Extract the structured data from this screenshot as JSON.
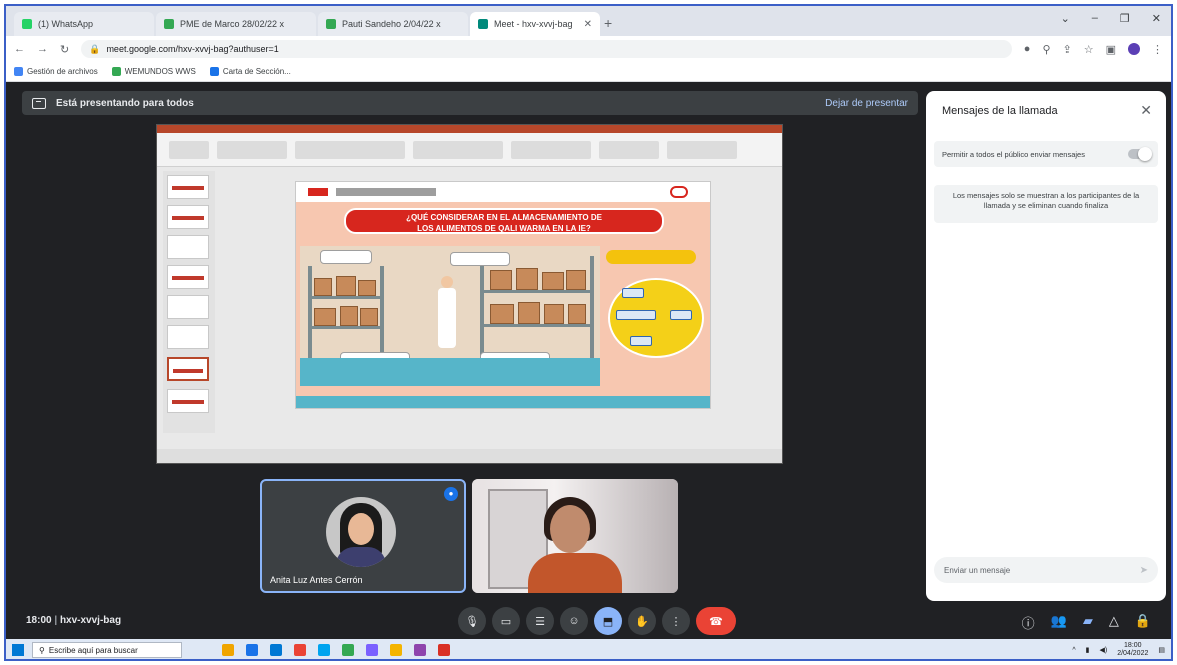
{
  "browser": {
    "tabs": [
      {
        "label": "(1) WhatsApp",
        "color": "#25d366",
        "active": false
      },
      {
        "label": "PME de Marco 28/02/22 x",
        "color": "#34a853",
        "active": false
      },
      {
        "label": "Pauti Sandeho 2/04/22 x",
        "color": "#34a853",
        "active": false
      },
      {
        "label": "Meet - hxv-xvvj-bag",
        "color": "#00897b",
        "active": true
      }
    ],
    "new_tab": "+",
    "window_controls": [
      "⌄",
      "–",
      "❐",
      "✕"
    ],
    "url": "meet.google.com/hxv-xvvj-bag?authuser=1",
    "bookmarks": [
      {
        "label": "Gestión de archivos",
        "color": "#4285f4"
      },
      {
        "label": "WEMUNDOS WWS",
        "color": "#34a853"
      },
      {
        "label": "Carta de Sección...",
        "color": "#1a73e8"
      }
    ]
  },
  "meet": {
    "presenting_label": "Está presentando para todos",
    "stop_presenting": "Dejar de presentar",
    "slide": {
      "title_line1": "¿QUÉ CONSIDERAR EN EL ALMACENAMIENTO DE",
      "title_line2": "LOS ALIMENTOS DE QALI WARMA EN LA IE?"
    },
    "participants": [
      {
        "name": "Anita Luz Antes Cerrón",
        "speaking": true
      },
      {
        "name": "",
        "speaking": false
      }
    ],
    "meeting_time": "18:00",
    "meeting_code": "hxv-xvvj-bag",
    "controls": [
      {
        "name": "mic",
        "glyph": "🎙"
      },
      {
        "name": "camera",
        "glyph": "▭"
      },
      {
        "name": "captions",
        "glyph": "☰"
      },
      {
        "name": "emoji",
        "glyph": "☺"
      },
      {
        "name": "present",
        "glyph": "⬒"
      },
      {
        "name": "raise-hand",
        "glyph": "✋"
      },
      {
        "name": "more",
        "glyph": "⋮"
      },
      {
        "name": "end-call",
        "glyph": "☎"
      }
    ],
    "right_controls": [
      {
        "name": "info",
        "glyph": "ⓘ"
      },
      {
        "name": "people",
        "glyph": "👥"
      },
      {
        "name": "chat",
        "glyph": "▰"
      },
      {
        "name": "activities",
        "glyph": "△"
      },
      {
        "name": "host-controls",
        "glyph": "🔒"
      }
    ]
  },
  "chat": {
    "title": "Mensajes de la llamada",
    "close": "✕",
    "toggle_label": "Permitir a todos el público enviar mensajes",
    "notice": "Los mensajes solo se muestran a los participantes de la llamada y se eliminan cuando finaliza",
    "input_placeholder": "Enviar un mensaje",
    "send": "➤"
  },
  "taskbar": {
    "search_placeholder": "Escribe aquí para buscar",
    "time": "18:00",
    "date": "2/04/2022",
    "app_colors": [
      "#f0a500",
      "#1a73e8",
      "#0078d4",
      "#ea4335",
      "#00a4ef",
      "#34a853",
      "#7b61ff",
      "#f4b400",
      "#8e44ad",
      "#d93025"
    ]
  }
}
